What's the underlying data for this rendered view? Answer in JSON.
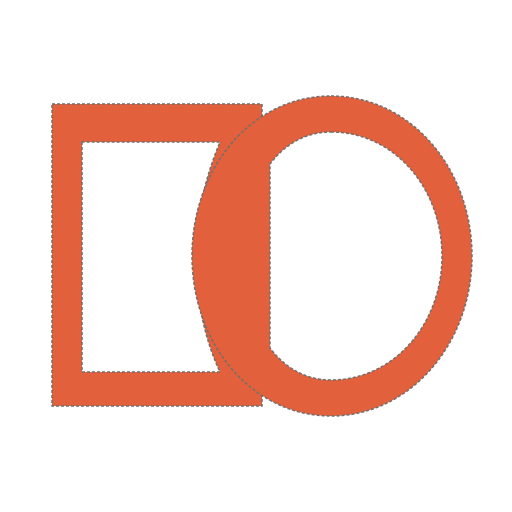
{
  "icon": {
    "name": "outlined-rectangle-and-ellipse-icon",
    "fill_color": "#E2603C",
    "edge_color": "#6F6F6F",
    "background_color": "#FFFFFF"
  }
}
